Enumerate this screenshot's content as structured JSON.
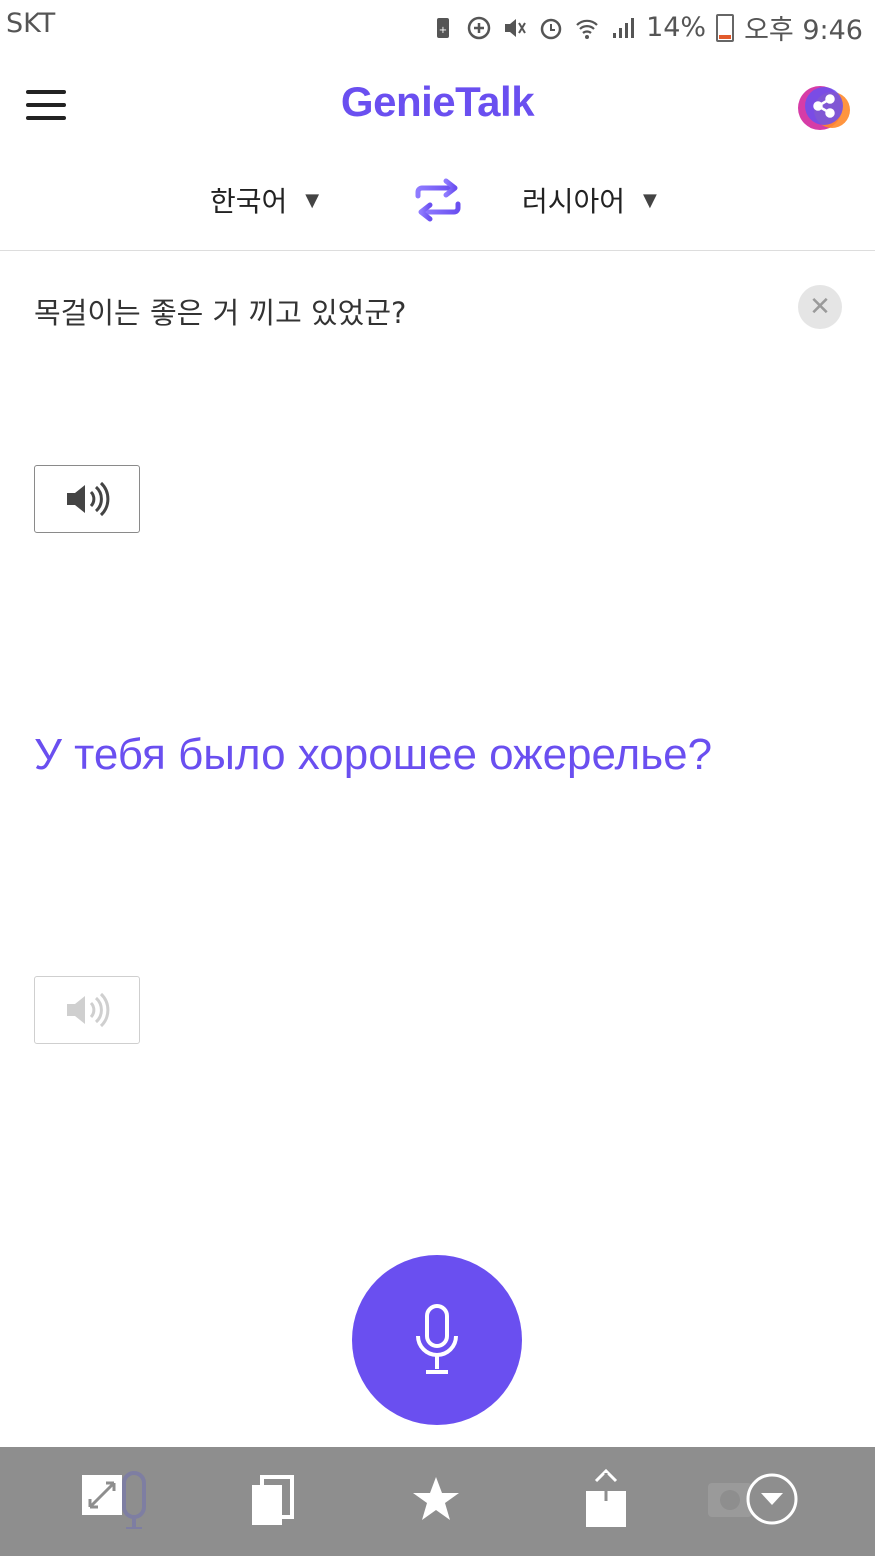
{
  "status_bar": {
    "carrier": "SKT",
    "battery": "14%",
    "time": "오후 9:46"
  },
  "header": {
    "logo": "GenieTalk",
    "menu_icon": "hamburger-menu-icon",
    "share_icon": "share-icon"
  },
  "languages": {
    "source": "한국어",
    "target": "러시아어",
    "swap_icon": "swap-arrows-icon"
  },
  "source": {
    "text": "목걸이는 좋은 거 끼고 있었군?",
    "clear_icon": "close-icon",
    "speak_icon": "speaker-icon"
  },
  "target": {
    "text": "У тебя было хорошее ожерелье?",
    "speak_icon": "speaker-icon"
  },
  "mic": {
    "icon": "microphone-icon"
  },
  "bottom_bar": {
    "items": [
      "expand-icon",
      "copy-icon",
      "star-icon",
      "share-upload-icon",
      "collapse-icon"
    ]
  },
  "colors": {
    "accent": "#6a4ff0",
    "bottom_bar": "#8e8e8e"
  }
}
